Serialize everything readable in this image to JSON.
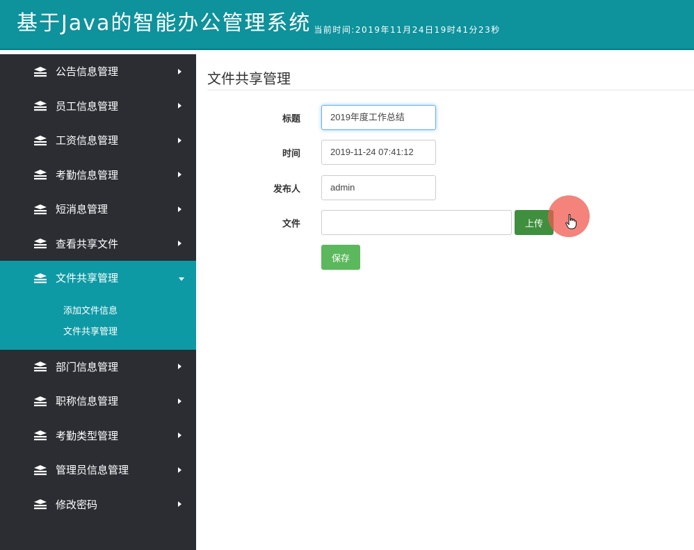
{
  "header": {
    "app_title": "基于Java的智能办公管理系统",
    "clock": "当前时间:2019年11月24日19时41分23秒"
  },
  "sidebar": {
    "items_top": [
      {
        "label": "公告信息管理"
      },
      {
        "label": "员工信息管理"
      },
      {
        "label": "工资信息管理"
      },
      {
        "label": "考勤信息管理"
      },
      {
        "label": "短消息管理"
      },
      {
        "label": "查看共享文件"
      }
    ],
    "active_item": {
      "label": "文件共享管理"
    },
    "submenu": [
      {
        "label": "添加文件信息"
      },
      {
        "label": "文件共享管理"
      }
    ],
    "items_bottom": [
      {
        "label": "部门信息管理"
      },
      {
        "label": "职称信息管理"
      },
      {
        "label": "考勤类型管理"
      },
      {
        "label": "管理员信息管理"
      },
      {
        "label": "修改密码"
      }
    ]
  },
  "main": {
    "page_title": "文件共享管理",
    "form": {
      "title_label": "标题",
      "title_value": "2019年度工作总结",
      "time_label": "时间",
      "time_value": "2019-11-24 07:41:12",
      "publisher_label": "发布人",
      "publisher_value": "admin",
      "file_label": "文件",
      "file_value": "",
      "upload_button": "上传",
      "save_button": "保存"
    }
  },
  "colors": {
    "header_bg": "#0e929c",
    "sidebar_bg": "#2b2d33",
    "active_bg": "#0e9aa5",
    "upload_button": "#3f8f3f",
    "save_button": "#5cb85c",
    "cursor_highlight": "#f05a50"
  },
  "icons": {
    "menu": "stack-icon",
    "arrow_right": "caret-right-icon",
    "arrow_down": "caret-down-icon",
    "cursor": "hand-pointer-icon"
  }
}
